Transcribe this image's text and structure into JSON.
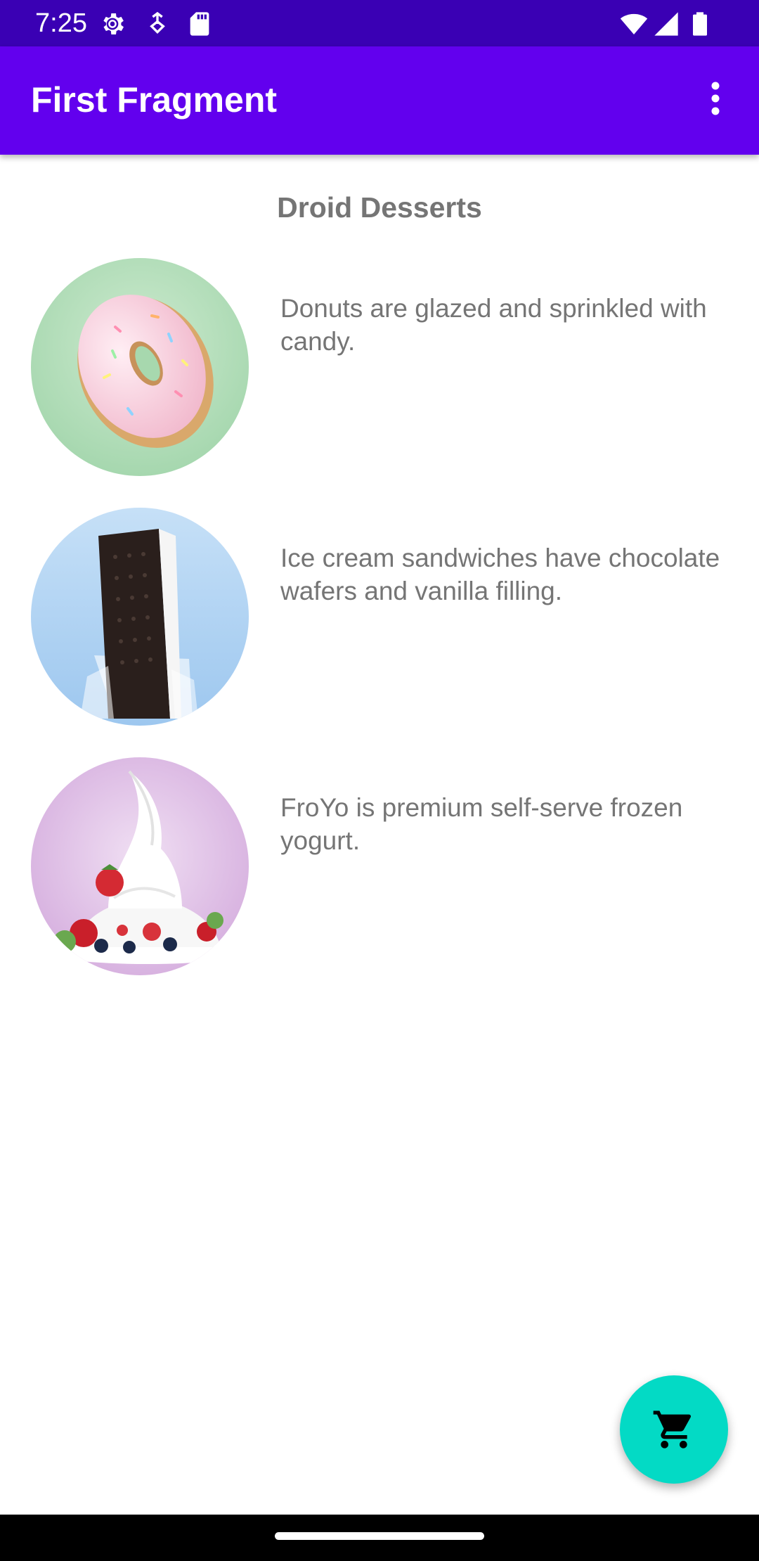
{
  "status_bar": {
    "time": "7:25",
    "icons": [
      "settings-gear-icon",
      "usb-debug-icon",
      "sd-card-icon",
      "wifi-icon",
      "cell-signal-icon",
      "battery-icon"
    ]
  },
  "app_bar": {
    "title": "First Fragment",
    "menu_icon": "more-vert-icon"
  },
  "main": {
    "title": "Droid Desserts",
    "desserts": [
      {
        "image": "donut-image",
        "description": "Donuts are glazed and sprinkled with candy."
      },
      {
        "image": "ice-cream-sandwich-image",
        "description": "Ice cream sandwiches have chocolate wafers and vanilla filling."
      },
      {
        "image": "froyo-image",
        "description": "FroYo is premium self-serve frozen yogurt."
      }
    ]
  },
  "fab": {
    "icon": "shopping-cart-icon"
  },
  "colors": {
    "status_bar": "#3a00b4",
    "app_bar": "#6200ee",
    "fab": "#03dac5",
    "text_secondary": "#757575"
  }
}
